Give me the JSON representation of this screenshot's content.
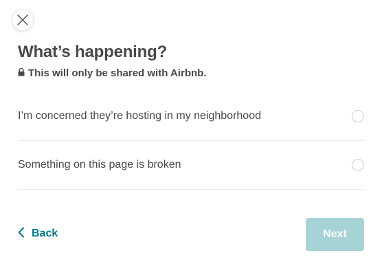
{
  "dialog": {
    "title": "What’s happening?",
    "subtitle": "This will only be shared with Airbnb."
  },
  "options": [
    {
      "label": "I’m concerned they’re hosting in my neighborhood",
      "selected": false
    },
    {
      "label": "Something on this page is broken",
      "selected": false
    }
  ],
  "footer": {
    "back_label": "Back",
    "next_label": "Next",
    "next_enabled": false
  },
  "icons": {
    "close": "close-icon",
    "lock": "lock-icon",
    "back": "chevron-left-icon"
  },
  "colors": {
    "text": "#484848",
    "accent": "#007a87",
    "next_disabled_bg": "#a6d3d6",
    "divider": "#ebebeb"
  }
}
